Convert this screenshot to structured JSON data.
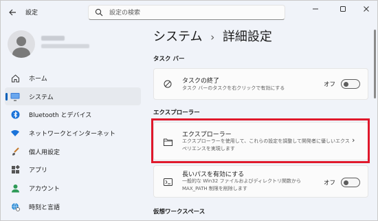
{
  "titlebar": {
    "back_icon": "arrow-left-icon",
    "app_title": "設定",
    "search_placeholder": "設定の検索",
    "search_icon": "search-icon",
    "minimize_icon": "minimize-icon",
    "maximize_icon": "maximize-icon",
    "close_icon": "close-icon"
  },
  "sidebar": {
    "profile": {
      "avatar_icon": "user-avatar-icon"
    },
    "items": [
      {
        "label": "ホーム",
        "icon": "home-icon",
        "active": false
      },
      {
        "label": "システム",
        "icon": "monitor-icon",
        "active": true
      },
      {
        "label": "Bluetooth とデバイス",
        "icon": "bluetooth-icon",
        "active": false
      },
      {
        "label": "ネットワークとインターネット",
        "icon": "wifi-icon",
        "active": false
      },
      {
        "label": "個人用設定",
        "icon": "brush-icon",
        "active": false
      },
      {
        "label": "アプリ",
        "icon": "apps-icon",
        "active": false
      },
      {
        "label": "アカウント",
        "icon": "account-icon",
        "active": false
      },
      {
        "label": "時刻と言語",
        "icon": "globe-clock-icon",
        "active": false
      }
    ]
  },
  "main": {
    "breadcrumb_parent": "システム",
    "breadcrumb_separator": "›",
    "breadcrumb_current": "詳細設定",
    "section_taskbar": "タスク バー",
    "task_end": {
      "title": "タスクの終了",
      "desc": "タスク バーのタスクを右クリックで有効にする",
      "toggle_label": "オフ",
      "toggle_on": false,
      "icon": "block-icon"
    },
    "section_explorer": "エクスプローラー",
    "explorer": {
      "title": "エクスプローラー",
      "desc_line1": "エクスプローラーを使用して、これらの設定を調整して開発者に優しいエクス",
      "desc_line2": "ペリエンスを実現します",
      "icon": "folder-icon",
      "chevron": "›"
    },
    "long_path": {
      "title": "長いパスを有効にする",
      "desc_line1": "一般的な Win32 ファイルおよびディレクトリ関数から",
      "desc_line2": "MAX_PATH 制限を削除します",
      "toggle_label": "オフ",
      "toggle_on": false,
      "icon": "path-icon"
    },
    "section_virtual_ws": "仮想ワークスペース"
  },
  "colors": {
    "accent": "#005fb8",
    "highlight": "#e0182b"
  }
}
